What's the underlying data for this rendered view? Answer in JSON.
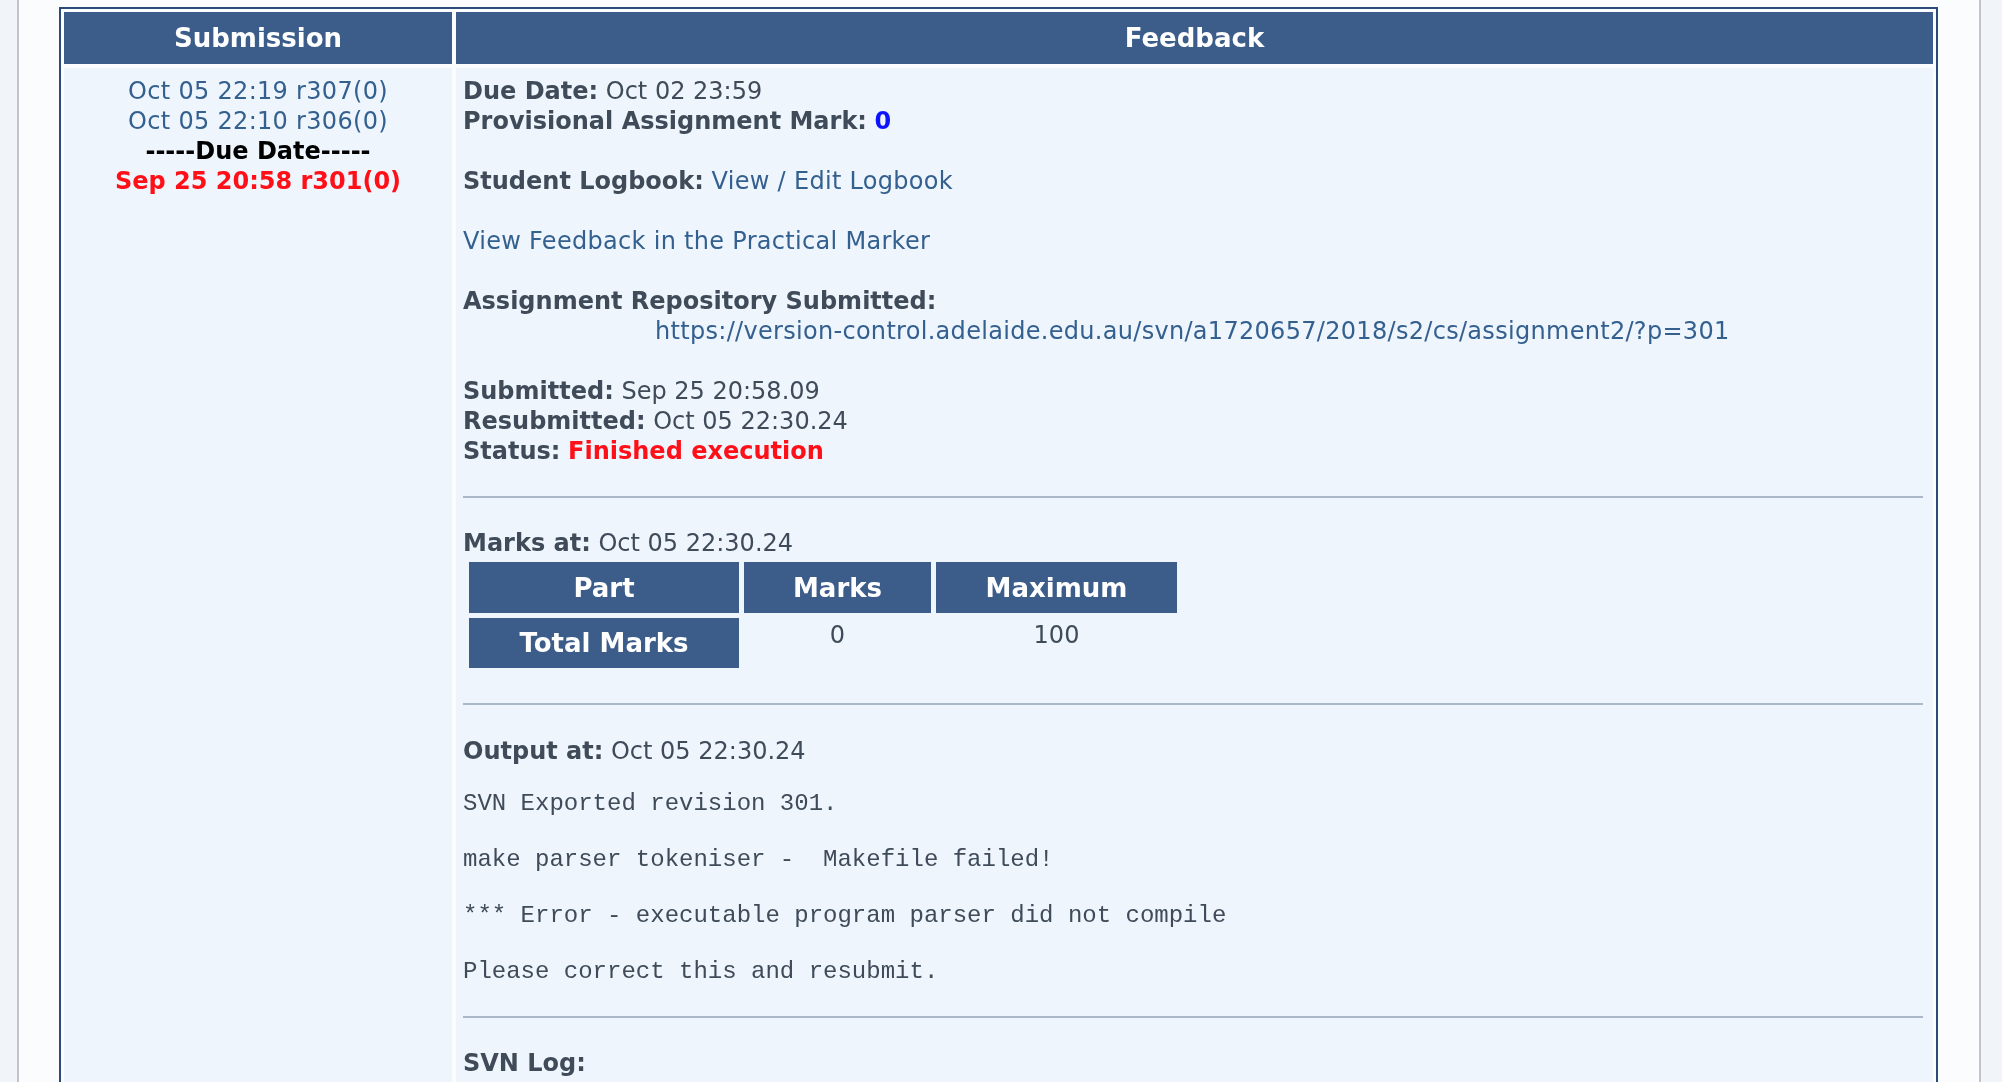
{
  "table": {
    "columns": [
      "Submission",
      "Feedback"
    ],
    "submissions": [
      {
        "kind": "submission",
        "text": "Oct 05 22:19 r307(0)",
        "selected": false
      },
      {
        "kind": "submission",
        "text": "Oct 05 22:10 r306(0)",
        "selected": false
      },
      {
        "kind": "due_marker",
        "text": "-----Due Date-----"
      },
      {
        "kind": "submission",
        "text": "Sep 25 20:58 r301(0)",
        "selected": true
      }
    ],
    "feedback": {
      "due_date": {
        "label": "Due Date:",
        "value": "Oct 02 23:59"
      },
      "provisional_mark": {
        "label": "Provisional Assignment Mark:",
        "value": "0"
      },
      "logbook": {
        "label": "Student Logbook:",
        "link": "View / Edit Logbook"
      },
      "practical_marker_link": "View Feedback in the Practical Marker",
      "repository": {
        "label": "Assignment Repository Submitted:",
        "url": "https://version-control.adelaide.edu.au/svn/a1720657/2018/s2/cs/assignment2/?p=301"
      },
      "submitted": {
        "label": "Submitted:",
        "value": "Sep 25 20:58.09"
      },
      "resubmitted": {
        "label": "Resubmitted:",
        "value": "Oct 05 22:30.24"
      },
      "status": {
        "label": "Status:",
        "value": "Finished execution"
      },
      "marks": {
        "label": "Marks at:",
        "value": "Oct 05 22:30.24",
        "columns": [
          "Part",
          "Marks",
          "Maximum"
        ],
        "rows": [
          {
            "part": "Total Marks",
            "marks": "0",
            "maximum": "100"
          }
        ]
      },
      "output": {
        "label": "Output at:",
        "value": "Oct 05 22:30.24",
        "lines": [
          "SVN Exported revision 301.",
          "make parser tokeniser -  Makefile failed!",
          "*** Error - executable program parser did not compile",
          "Please correct this and resubmit."
        ]
      },
      "svn_log": {
        "label": "SVN Log:"
      }
    }
  }
}
